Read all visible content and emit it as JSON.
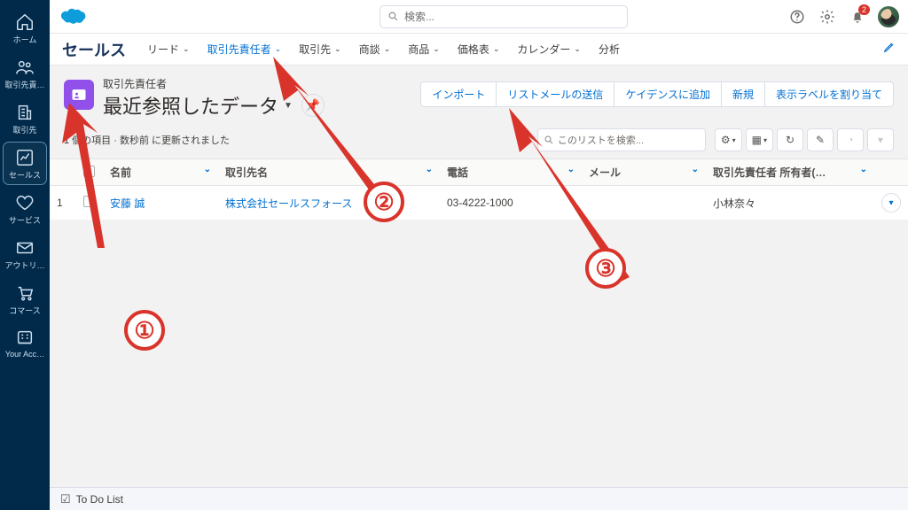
{
  "vnav": [
    {
      "id": "home",
      "label": "ホーム"
    },
    {
      "id": "contacts",
      "label": "取引先責…"
    },
    {
      "id": "accounts",
      "label": "取引先"
    },
    {
      "id": "sales",
      "label": "セールス"
    },
    {
      "id": "service",
      "label": "サービス"
    },
    {
      "id": "outreach",
      "label": "アウトリ…"
    },
    {
      "id": "commerce",
      "label": "コマース"
    },
    {
      "id": "your-acc",
      "label": "Your Acc…"
    }
  ],
  "vnav_selected": "sales",
  "header": {
    "search_placeholder": "検索...",
    "notif_count": "2"
  },
  "nav2": {
    "app_name": "セールス",
    "items": [
      {
        "id": "leads",
        "label": "リード"
      },
      {
        "id": "contacts",
        "label": "取引先責任者"
      },
      {
        "id": "accounts",
        "label": "取引先"
      },
      {
        "id": "opps",
        "label": "商談"
      },
      {
        "id": "products",
        "label": "商品"
      },
      {
        "id": "pricebooks",
        "label": "価格表"
      },
      {
        "id": "calendar",
        "label": "カレンダー"
      },
      {
        "id": "analytics",
        "label": "分析"
      }
    ],
    "active": "contacts"
  },
  "object_header": {
    "object_label": "取引先責任者",
    "list_title": "最近参照したデータ"
  },
  "action_buttons": [
    {
      "id": "import",
      "label": "インポート"
    },
    {
      "id": "send-list-email",
      "label": "リストメールの送信"
    },
    {
      "id": "add-cadence",
      "label": "ケイデンスに追加"
    },
    {
      "id": "new",
      "label": "新規"
    },
    {
      "id": "assign-labels",
      "label": "表示ラベルを割り当て"
    }
  ],
  "meta_text": "1 個の項目 · 数秒前 に更新されました",
  "list_search_placeholder": "このリストを検索...",
  "columns": [
    {
      "id": "name",
      "label": "名前"
    },
    {
      "id": "account",
      "label": "取引先名"
    },
    {
      "id": "phone",
      "label": "電話"
    },
    {
      "id": "email",
      "label": "メール"
    },
    {
      "id": "owner",
      "label": "取引先責任者 所有者(…"
    }
  ],
  "rows": [
    {
      "num": "1",
      "name": "安藤 誠",
      "account": "株式会社セールスフォース",
      "phone": "03-4222-1000",
      "email": "",
      "owner": "小林奈々"
    }
  ],
  "footer": {
    "todo": "To Do List"
  },
  "annotations": {
    "b1": "①",
    "b2": "②",
    "b3": "③"
  }
}
